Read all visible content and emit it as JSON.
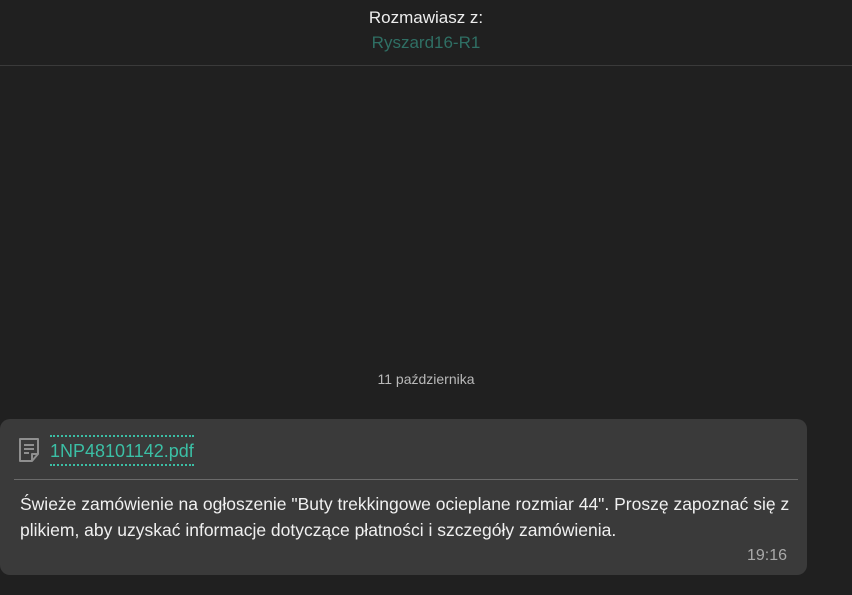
{
  "header": {
    "label": "Rozmawiasz z:",
    "contact_name": "Ryszard16-R1"
  },
  "chat": {
    "date_separator": "11 października",
    "message": {
      "attachment": {
        "icon": "document-icon",
        "filename": "1NP48101142.pdf"
      },
      "text": "Świeże zamówienie na ogłoszenie \"Buty trekkingowe ocieplane rozmiar 44\". Proszę zapoznać się z plikiem, aby uzyskać informacje dotyczące płatności i szczegóły zamówienia.",
      "time": "19:16"
    }
  },
  "colors": {
    "background": "#202020",
    "bubble": "#3a3a3a",
    "accent_link": "#3bbfa5",
    "contact_name": "#2f6f64"
  }
}
